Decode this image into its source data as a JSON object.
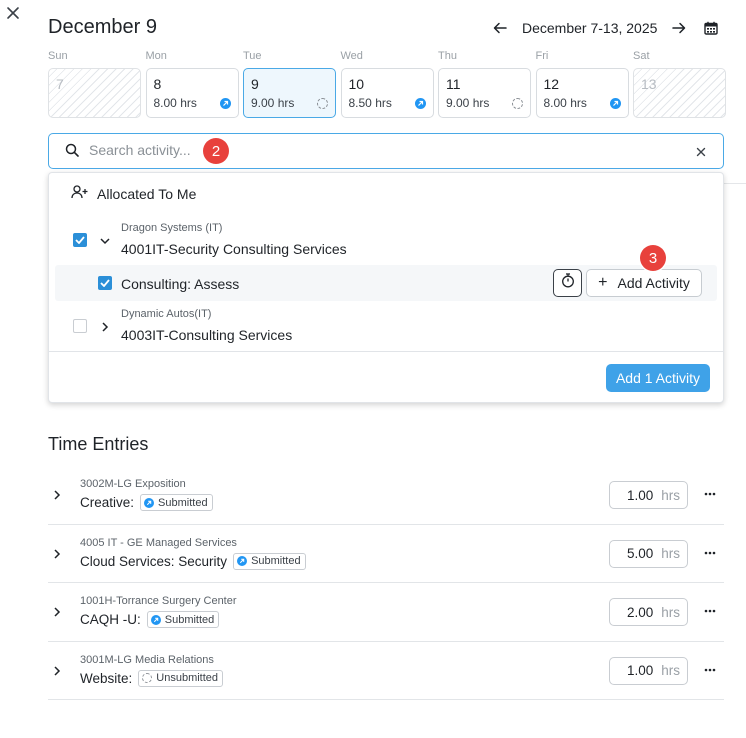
{
  "header": {
    "title": "December 9",
    "week_range": "December 7-13, 2025"
  },
  "days": [
    {
      "name": "Sun",
      "num": "7",
      "hours": "",
      "status": "none",
      "type": "weekend"
    },
    {
      "name": "Mon",
      "num": "8",
      "hours": "8.00 hrs",
      "status": "submitted",
      "type": "normal"
    },
    {
      "name": "Tue",
      "num": "9",
      "hours": "9.00 hrs",
      "status": "unsubmitted",
      "type": "selected"
    },
    {
      "name": "Wed",
      "num": "10",
      "hours": "8.50 hrs",
      "status": "submitted",
      "type": "normal"
    },
    {
      "name": "Thu",
      "num": "11",
      "hours": "9.00 hrs",
      "status": "unsubmitted",
      "type": "normal"
    },
    {
      "name": "Fri",
      "num": "12",
      "hours": "8.00 hrs",
      "status": "submitted",
      "type": "normal"
    },
    {
      "name": "Sat",
      "num": "13",
      "hours": "",
      "status": "none",
      "type": "weekend"
    }
  ],
  "search": {
    "placeholder": "Search activity...",
    "value": ""
  },
  "annotations": {
    "step2": "2",
    "step3": "3"
  },
  "dropdown": {
    "section_title": "Allocated To Me",
    "projects": [
      {
        "client": "Dragon Systems (IT)",
        "name": "4001IT-Security Consulting Services",
        "checked": true,
        "expanded": true,
        "activities": [
          {
            "label": "Consulting: Assess",
            "checked": true,
            "add_label": "Add Activity"
          }
        ]
      },
      {
        "client": "Dynamic Autos(IT)",
        "name": "4003IT-Consulting Services",
        "checked": false,
        "expanded": false,
        "activities": []
      }
    ],
    "add_button": "Add 1 Activity"
  },
  "time_entries": {
    "title": "Time Entries",
    "hours_unit": "hrs",
    "rows": [
      {
        "project": "3002M-LG Exposition",
        "activity": "Creative:",
        "status": "Submitted",
        "status_type": "submitted",
        "hours": "1.00"
      },
      {
        "project": "4005 IT - GE Managed Services",
        "activity": "Cloud Services: Security",
        "status": "Submitted",
        "status_type": "submitted",
        "hours": "5.00"
      },
      {
        "project": "1001H-Torrance Surgery Center",
        "activity": "CAQH -U:",
        "status": "Submitted",
        "status_type": "submitted",
        "hours": "2.00"
      },
      {
        "project": "3001M-LG Media Relations",
        "activity": "Website:",
        "status": "Unsubmitted",
        "status_type": "unsubmitted",
        "hours": "1.00"
      }
    ]
  },
  "colors": {
    "accent": "#3fa2e8",
    "selected_border": "#4aa9e6",
    "submitted_dot": "#2196f3",
    "annotation_red": "#e8413c"
  }
}
